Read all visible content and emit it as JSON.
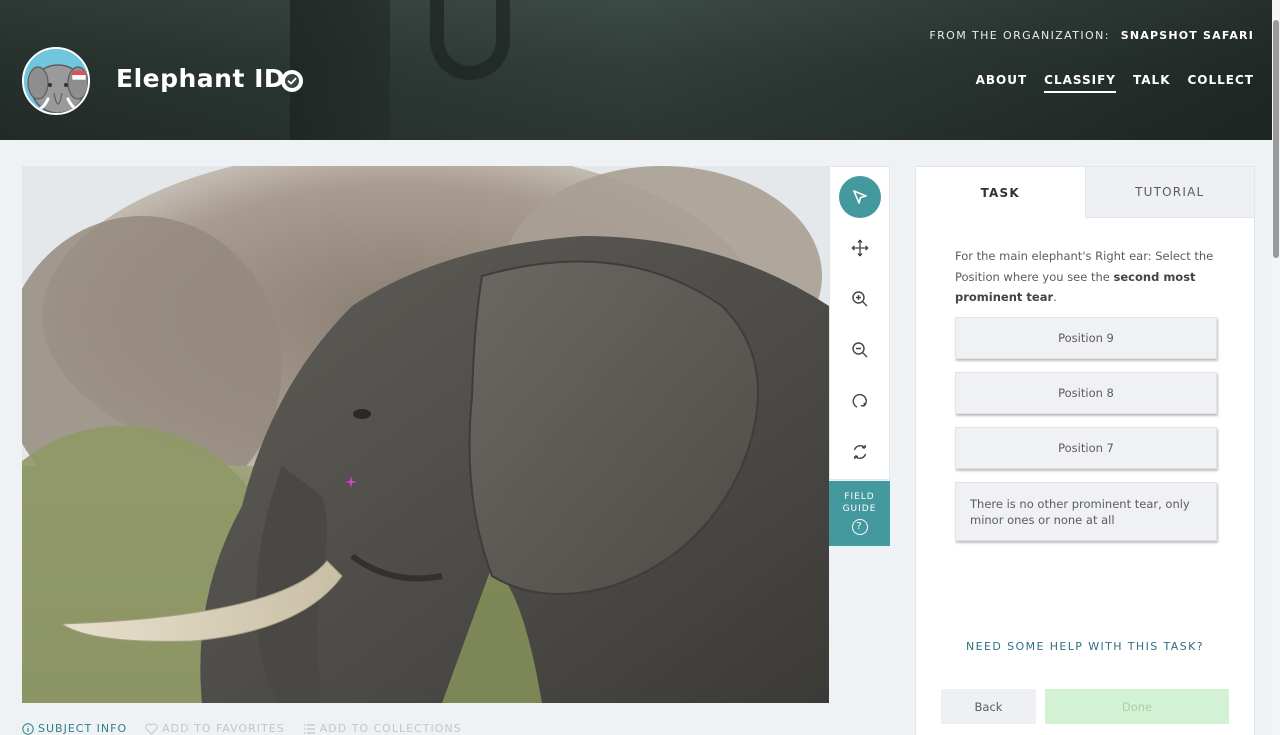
{
  "header": {
    "project_title": "Elephant ID",
    "org_prefix": "FROM THE ORGANIZATION:",
    "org_name": "SNAPSHOT SAFARI",
    "nav": [
      "ABOUT",
      "CLASSIFY",
      "TALK",
      "COLLECT"
    ],
    "active_nav": "CLASSIFY"
  },
  "tools": [
    "pointer-icon",
    "move-icon",
    "zoom-in-icon",
    "zoom-out-icon",
    "rotate-icon",
    "reset-icon"
  ],
  "field_guide": {
    "line1": "FIELD",
    "line2": "GUIDE",
    "icon": "?"
  },
  "subject_meta": {
    "subject_info": "SUBJECT INFO",
    "add_favorites": "ADD TO FAVORITES",
    "add_collections": "ADD TO COLLECTIONS"
  },
  "task": {
    "tabs": [
      "TASK",
      "TUTORIAL"
    ],
    "question_pre": "For the main elephant's Right ear: Select the Position where you see the ",
    "question_bold": "second most prominent tear",
    "question_post": ".",
    "answers": [
      "Position 9",
      "Position 8",
      "Position 7",
      "There is no other prominent tear, only minor ones or none at all"
    ],
    "help": "NEED SOME HELP WITH THIS TASK?",
    "back_label": "Back",
    "done_label": "Done"
  },
  "colors": {
    "accent": "#43999e",
    "done_bg": "#d3f2d3",
    "marker": "#e040e0"
  }
}
